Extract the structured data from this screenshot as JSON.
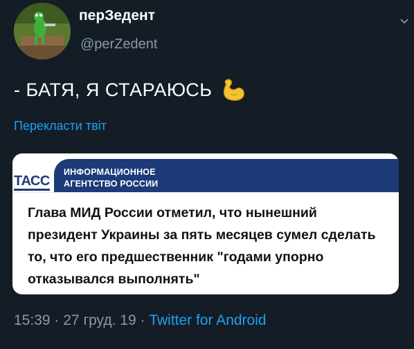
{
  "author": {
    "display_name": "перЗедент",
    "handle": "@perZedent"
  },
  "tweet": {
    "text": "- БАТЯ, Я СТАРАЮСЬ",
    "emoji_icon": "flexed-biceps-icon",
    "translate_link": "Перекласти твіт"
  },
  "embedded_card": {
    "logo_text": "ТАСС",
    "agency_line1": "ИНФОРМАЦИОННОЕ",
    "agency_line2": "АГЕНТСТВО РОССИИ",
    "headline": "Глава МИД России отметил, что нынешний президент Украины за пять месяцев сумел сделать то, что его предшественник \"годами упорно отказывался выполнять\""
  },
  "meta": {
    "time": "15:39",
    "separator": "·",
    "date": "27 груд. 19",
    "client": "Twitter for Android"
  },
  "colors": {
    "background": "#141d26",
    "link": "#1da1f2",
    "muted": "#8899a6",
    "tass_blue": "#1d3a79"
  }
}
